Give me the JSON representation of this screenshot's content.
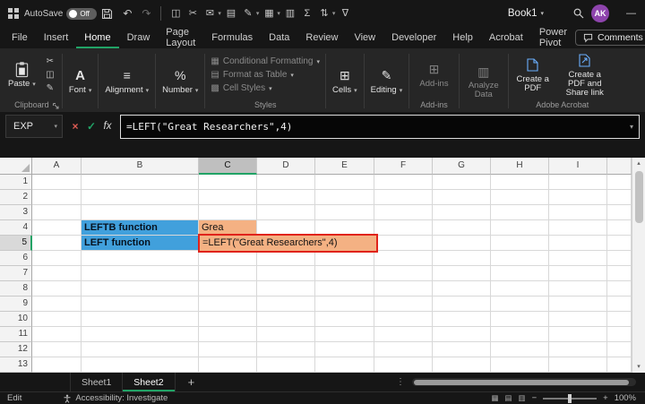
{
  "theme": {
    "accent_green": "#21A366",
    "avatar_purple": "#8E44AD"
  },
  "titlebar": {
    "autosave_label": "AutoSave",
    "autosave_state": "Off",
    "qat_icons": [
      {
        "name": "copy-icon",
        "glyph": "◫"
      },
      {
        "name": "cut-icon",
        "glyph": "✂"
      },
      {
        "name": "mail-icon",
        "glyph": "✉",
        "dropdown": true
      },
      {
        "name": "print-icon",
        "glyph": "▤"
      },
      {
        "name": "format-painter-icon",
        "glyph": "✎",
        "dropdown": true
      },
      {
        "name": "chart-icon",
        "glyph": "▦",
        "dropdown": true
      },
      {
        "name": "table-icon",
        "glyph": "▥"
      },
      {
        "name": "autosum-icon",
        "glyph": "Σ"
      },
      {
        "name": "sort-icon",
        "glyph": "⇅",
        "dropdown": true
      },
      {
        "name": "filter-icon",
        "glyph": "∇"
      }
    ],
    "title": "Book1",
    "avatar_initials": "AK",
    "minimize_glyph": "—"
  },
  "tab_bar": {
    "tabs": [
      "File",
      "Insert",
      "Home",
      "Draw",
      "Page Layout",
      "Formulas",
      "Data",
      "Review",
      "View",
      "Developer",
      "Help",
      "Acrobat",
      "Power Pivot"
    ],
    "active_tab": "Home",
    "comments_label": "Comments"
  },
  "ribbon": {
    "paste_label": "Paste",
    "clipboard_label": "Clipboard",
    "font_label": "Font",
    "alignment_label": "Alignment",
    "number_label": "Number",
    "styles": {
      "conditional_formatting": "Conditional Formatting",
      "format_as_table": "Format as Table",
      "cell_styles": "Cell Styles",
      "group_label": "Styles"
    },
    "cells_label": "Cells",
    "editing_label": "Editing",
    "addins_label": "Add-ins",
    "addins_group_label": "Add-ins",
    "analyze_label": "Analyze Data",
    "acrobat": {
      "create_pdf": "Create a PDF",
      "create_share": "Create a PDF and Share link",
      "group_label": "Adobe Acrobat"
    }
  },
  "formula_bar": {
    "name_box": "EXP",
    "formula": "=LEFT(\"Great Researchers\",4)"
  },
  "grid": {
    "columns": [
      "A",
      "B",
      "C",
      "D",
      "E",
      "F",
      "G",
      "H",
      "I"
    ],
    "row_count": 13,
    "selected_column": "C",
    "selected_row": "5",
    "cells": [
      {
        "ref": "B4",
        "text": "LEFTB function",
        "style": "blue"
      },
      {
        "ref": "B5",
        "text": "LEFT function",
        "style": "blue"
      },
      {
        "ref": "C4",
        "text": "Grea",
        "style": "orange"
      },
      {
        "ref": "C5",
        "text": "=LEFT(\"Great Researchers\",4)",
        "style": "editing"
      }
    ],
    "colors": {
      "blue_fill": "#41A0DC",
      "orange_fill": "#F4B183",
      "edit_border": "#E0231B"
    }
  },
  "sheet_bar": {
    "tabs": [
      "Sheet1",
      "Sheet2"
    ],
    "active": "Sheet2",
    "add_label": "+"
  },
  "status_bar": {
    "mode": "Edit",
    "accessibility": "Accessibility: Investigate",
    "zoom_out": "−",
    "zoom_in": "+",
    "zoom_level": "100%"
  }
}
